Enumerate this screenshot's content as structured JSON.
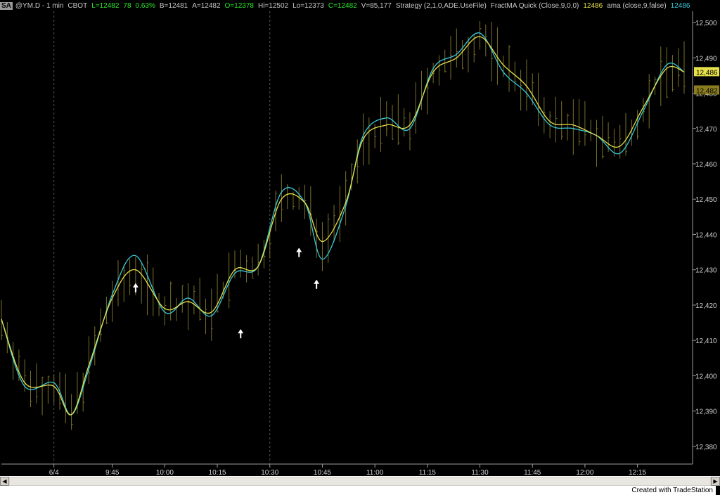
{
  "header": {
    "tag": "SA",
    "symbol": "@YM.D - 1 min",
    "exchange": "CBOT",
    "last": "L=12482",
    "change": "78",
    "change_pct": "0.63%",
    "bid": "B=12481",
    "ask": "A=12482",
    "open": "O=12378",
    "high": "Hi=12502",
    "low": "Lo=12373",
    "close": "C=12482",
    "volume": "V=85,177",
    "strategy": "Strategy (2,1,0,ADE.UseFile)",
    "fract_label": "FractMA Quick (Close,9,0,0)",
    "fract_value": "12486",
    "ama_label": "ama (close,9,false)",
    "ama_value": "12486"
  },
  "price_tags": {
    "upper": "12,486",
    "lower": "12,482"
  },
  "footer": {
    "credit": "Created with TradeStation"
  },
  "colors": {
    "background": "#000000",
    "bars": "#7a6f2a",
    "fract_ma": "#e6e04a",
    "ama": "#37c9d9",
    "grid": "#3a3a3a",
    "axis_text": "#d0d0d0"
  },
  "chart_data": {
    "type": "line",
    "title": "",
    "xlabel": "",
    "ylabel": "",
    "ylim": [
      12375,
      12502
    ],
    "yticks": [
      12380,
      12390,
      12400,
      12410,
      12420,
      12430,
      12440,
      12450,
      12460,
      12470,
      12480,
      12490,
      12500
    ],
    "ytick_labels": [
      "12,380",
      "12,390",
      "12,400",
      "12,410",
      "12,420",
      "12,430",
      "12,440",
      "12,450",
      "12,460",
      "12,470",
      "12,480",
      "12,490",
      "12,500"
    ],
    "x_range": [
      0,
      117
    ],
    "xticks": [
      {
        "x": 9,
        "label": "6/4"
      },
      {
        "x": 19,
        "label": "9:45"
      },
      {
        "x": 28,
        "label": "10:00"
      },
      {
        "x": 37,
        "label": "10:15"
      },
      {
        "x": 46,
        "label": "10:30"
      },
      {
        "x": 55,
        "label": "10:45"
      },
      {
        "x": 64,
        "label": "11:00"
      },
      {
        "x": 73,
        "label": "11:15"
      },
      {
        "x": 82,
        "label": "11:30"
      },
      {
        "x": 91,
        "label": "11:45"
      },
      {
        "x": 100,
        "label": "12:00"
      },
      {
        "x": 109,
        "label": "12:15"
      }
    ],
    "vlines": [
      9,
      46
    ],
    "arrows": [
      {
        "x": 23,
        "y": 12426
      },
      {
        "x": 41,
        "y": 12413
      },
      {
        "x": 51,
        "y": 12436
      },
      {
        "x": 54,
        "y": 12427
      }
    ],
    "series": [
      {
        "label": "FractMA Quick",
        "x": [
          0,
          4,
          9,
          12,
          15,
          19,
          23,
          28,
          32,
          36,
          40,
          44,
          48,
          52,
          55,
          59,
          62,
          66,
          70,
          74,
          78,
          82,
          86,
          90,
          94,
          98,
          102,
          106,
          110,
          114,
          117
        ],
        "values": [
          12416,
          12398,
          12397,
          12389,
          12403,
          12422,
          12430,
          12419,
          12421,
          12418,
          12430,
          12431,
          12450,
          12449,
          12438,
          12449,
          12467,
          12471,
          12471,
          12486,
          12490,
          12496,
          12488,
          12482,
          12472,
          12471,
          12468,
          12465,
          12476,
          12487,
          12486
        ]
      },
      {
        "label": "ama",
        "x": [
          0,
          4,
          9,
          12,
          15,
          19,
          23,
          28,
          32,
          36,
          40,
          44,
          48,
          52,
          55,
          59,
          62,
          66,
          70,
          74,
          78,
          82,
          86,
          90,
          94,
          98,
          102,
          106,
          110,
          114,
          117
        ],
        "values": [
          12416,
          12397,
          12398,
          12389,
          12402,
          12423,
          12434,
          12418,
          12422,
          12417,
          12429,
          12431,
          12452,
          12449,
          12433,
          12448,
          12468,
          12473,
          12470,
          12487,
          12491,
          12497,
          12486,
          12480,
          12471,
          12470,
          12468,
          12463,
          12475,
          12488,
          12486
        ]
      }
    ]
  }
}
